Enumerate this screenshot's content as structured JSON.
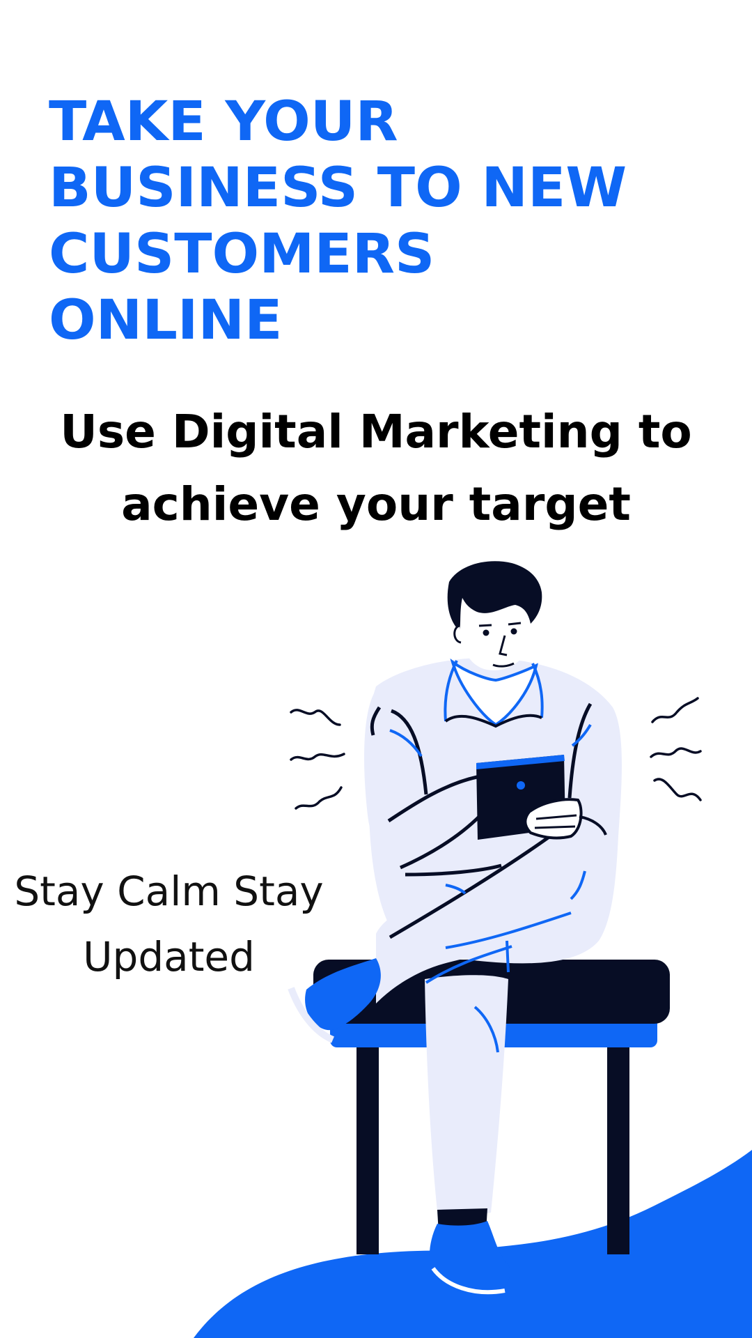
{
  "headline": {
    "lines": [
      "TAKE YOUR",
      "BUSINESS TO NEW",
      "CUSTOMERS",
      "ONLINE"
    ]
  },
  "subheadline": {
    "lines": [
      "Use Digital Marketing to",
      "achieve your target"
    ]
  },
  "tagline": {
    "lines": [
      "Stay Calm Stay",
      "Updated"
    ]
  },
  "colors": {
    "accent_blue": "#0f67f5",
    "navy": "#070d25",
    "light_lavender": "#e9ecfb",
    "background": "#ffffff",
    "text_dark": "#000000"
  },
  "illustration": {
    "subject": "person-sitting-on-bench-using-tablet-icon"
  }
}
